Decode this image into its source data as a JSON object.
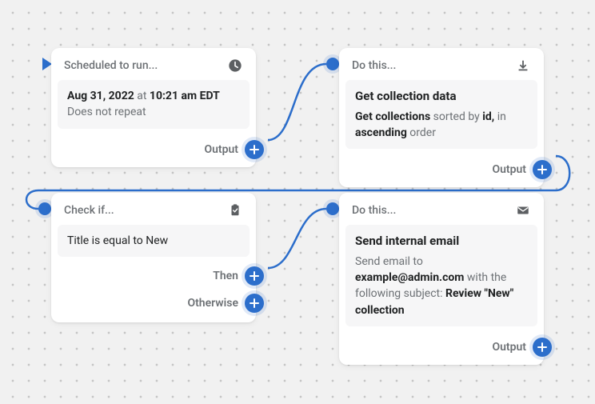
{
  "colors": {
    "accent": "#2c6ecb"
  },
  "card1": {
    "header": "Scheduled to run...",
    "icon": "clock-icon",
    "date_strong": "Aug 31, 2022",
    "date_at": " at ",
    "time_strong": "10:21 am EDT",
    "repeat": "Does not repeat",
    "output": "Output"
  },
  "card2": {
    "header": "Do this...",
    "icon": "download-icon",
    "title": "Get collection data",
    "desc_pre": "Get collections",
    "desc_mid": " sorted by ",
    "desc_id": "id,",
    "desc_in": " in ",
    "desc_asc": "ascending",
    "desc_tail": " order",
    "output": "Output"
  },
  "card3": {
    "header": "Check if...",
    "icon": "clipboard-icon",
    "condition": "Title is equal to New",
    "then": "Then",
    "otherwise": "Otherwise"
  },
  "card4": {
    "header": "Do this...",
    "icon": "mail-icon",
    "title": "Send internal email",
    "l1": "Send email to ",
    "email": "example@admin.com",
    "l2": " with the following subject: ",
    "subject": "Review \"New\" collection",
    "output": "Output"
  }
}
